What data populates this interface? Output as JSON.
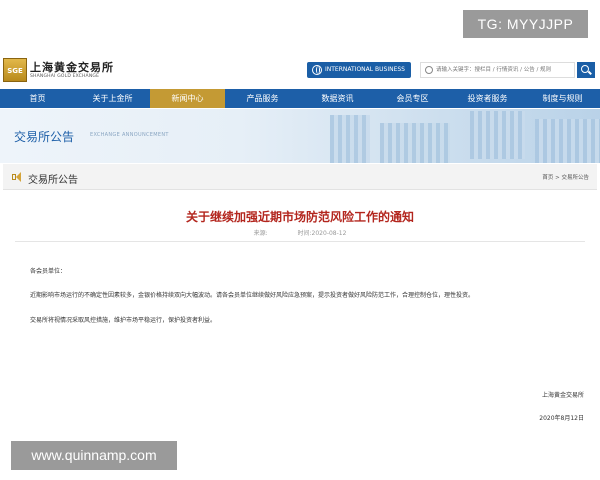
{
  "watermarks": {
    "top": "TG: MYYJJPP",
    "bottom": "www.quinnamp.com"
  },
  "header": {
    "logo_mark": "SGE",
    "logo_cn": "上海黄金交易所",
    "logo_en": "SHANGHAI GOLD EXCHANGE",
    "intl_button": "INTERNATIONAL BUSINESS",
    "search_placeholder": "请输入关键字：搜栏目 / 行情资讯 / 公告 / 规则",
    "icons": [
      "globe-icon",
      "search-icon"
    ]
  },
  "nav": {
    "items": [
      "首页",
      "关于上金所",
      "新闻中心",
      "产品服务",
      "数据资讯",
      "会员专区",
      "投资者服务",
      "制度与规则"
    ],
    "active_index": 2,
    "active_color": "#c49a34",
    "bar_color": "#1d5fa8"
  },
  "banner": {
    "title": "交易所公告",
    "subtitle_en": "EXCHANGE ANNOUNCEMENT"
  },
  "section": {
    "title": "交易所公告",
    "icon": "speaker-icon",
    "breadcrumb": [
      "首页",
      "交易所公告"
    ],
    "breadcrumb_sep": " > "
  },
  "article": {
    "title": "关于继续加强近期市场防范风险工作的通知",
    "title_color": "#b3261e",
    "source_label": "来源:",
    "source_value": "",
    "time_label": "时间:",
    "time_value": "2020-08-12",
    "greeting": "各会员单位：",
    "paragraph1": "近期影响市场运行的不确定性因素较多，金银价格持续双向大幅波动。请各会员单位继续做好风险应急预案，提示投资者做好风险防范工作，合理控制仓位，理性投资。",
    "paragraph2": "交易所将视情况采取风控措施，维护市场平稳运行，保护投资者利益。",
    "signature": "上海黄金交易所",
    "date": "2020年8月12日"
  }
}
